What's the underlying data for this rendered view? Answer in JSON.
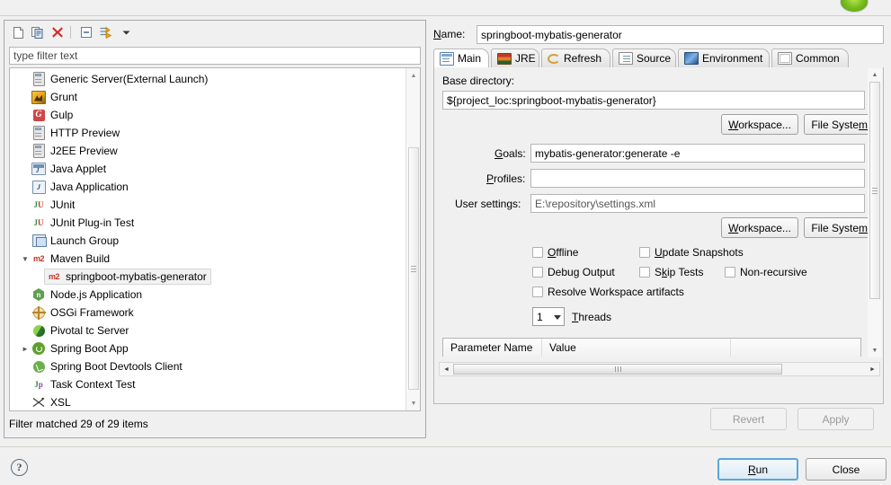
{
  "window": {
    "title_icon": "run-green-circle-icon"
  },
  "left_panel": {
    "toolbar": [
      {
        "name": "new-launch-configuration",
        "icon": "new-file-icon"
      },
      {
        "name": "duplicate-launch-configuration",
        "icon": "copy-icon"
      },
      {
        "name": "delete-launch-configuration",
        "icon": "delete-red-x-icon"
      },
      {
        "name": "collapse-all",
        "icon": "collapse-all-icon"
      },
      {
        "name": "filter-launch-configurations",
        "icon": "filter-arrow-icon"
      },
      {
        "name": "view-menu",
        "icon": "chevron-down-icon"
      }
    ],
    "filter": {
      "value": "",
      "placeholder": "type filter text"
    },
    "tree": [
      {
        "label": "Generic Server(External Launch)",
        "icon": "server-icon",
        "indent": 0,
        "twisty": "",
        "selected": false
      },
      {
        "label": "Grunt",
        "icon": "grunt-icon",
        "indent": 0,
        "twisty": "",
        "selected": false
      },
      {
        "label": "Gulp",
        "icon": "gulp-icon",
        "indent": 0,
        "twisty": "",
        "selected": false
      },
      {
        "label": "HTTP Preview",
        "icon": "server-icon",
        "indent": 0,
        "twisty": "",
        "selected": false
      },
      {
        "label": "J2EE Preview",
        "icon": "server-icon",
        "indent": 0,
        "twisty": "",
        "selected": false
      },
      {
        "label": "Java Applet",
        "icon": "java-applet-icon",
        "indent": 0,
        "twisty": "",
        "selected": false
      },
      {
        "label": "Java Application",
        "icon": "java-application-icon",
        "indent": 0,
        "twisty": "",
        "selected": false
      },
      {
        "label": "JUnit",
        "icon": "junit-icon",
        "indent": 0,
        "twisty": "",
        "selected": false
      },
      {
        "label": "JUnit Plug-in Test",
        "icon": "junit-plugin-icon",
        "indent": 0,
        "twisty": "",
        "selected": false
      },
      {
        "label": "Launch Group",
        "icon": "launch-group-icon",
        "indent": 0,
        "twisty": "",
        "selected": false
      },
      {
        "label": "Maven Build",
        "icon": "maven-m2-icon",
        "indent": 0,
        "twisty": "expanded",
        "selected": false
      },
      {
        "label": "springboot-mybatis-generator",
        "icon": "maven-m2-icon",
        "indent": 1,
        "twisty": "",
        "selected": true
      },
      {
        "label": "Node.js Application",
        "icon": "nodejs-icon",
        "indent": 0,
        "twisty": "",
        "selected": false
      },
      {
        "label": "OSGi Framework",
        "icon": "osgi-icon",
        "indent": 0,
        "twisty": "",
        "selected": false
      },
      {
        "label": "Pivotal tc Server",
        "icon": "pivotal-icon",
        "indent": 0,
        "twisty": "",
        "selected": false
      },
      {
        "label": "Spring Boot App",
        "icon": "spring-boot-icon",
        "indent": 0,
        "twisty": "collapsed",
        "selected": false
      },
      {
        "label": "Spring Boot Devtools Client",
        "icon": "spring-devtools-icon",
        "indent": 0,
        "twisty": "",
        "selected": false
      },
      {
        "label": "Task Context Test",
        "icon": "task-context-test-icon",
        "indent": 0,
        "twisty": "",
        "selected": false
      },
      {
        "label": "XSL",
        "icon": "xsl-icon",
        "indent": 0,
        "twisty": "",
        "selected": false
      }
    ],
    "status": "Filter matched 29 of 29 items"
  },
  "right_panel": {
    "name_label": "Name:",
    "name_value": "springboot-mybatis-generator",
    "tabs": [
      {
        "label": "Main",
        "icon": "main-tab-icon",
        "active": true
      },
      {
        "label": "JRE",
        "icon": "jre-icon",
        "active": false
      },
      {
        "label": "Refresh",
        "icon": "refresh-icon",
        "active": false
      },
      {
        "label": "Source",
        "icon": "source-icon",
        "active": false
      },
      {
        "label": "Environment",
        "icon": "environment-icon",
        "active": false
      },
      {
        "label": "Common",
        "icon": "common-icon",
        "active": false
      }
    ],
    "main_tab": {
      "base_directory_label": "Base directory:",
      "base_directory_value": "${project_loc:springboot-mybatis-generator}",
      "workspace_button_1": "Workspace...",
      "file_system_button_1": "File System..",
      "goals_label": "Goals:",
      "goals_value": "mybatis-generator:generate -e",
      "profiles_label": "Profiles:",
      "profiles_value": "",
      "user_settings_label": "User settings:",
      "user_settings_value": "E:\\repository\\settings.xml",
      "workspace_button_2": "Workspace...",
      "file_system_button_2": "File System..",
      "checkboxes": [
        {
          "label": "Offline",
          "checked": false
        },
        {
          "label": "Update Snapshots",
          "checked": false
        },
        {
          "label": "Debug Output",
          "checked": false
        },
        {
          "label": "Skip Tests",
          "checked": false
        },
        {
          "label": "Non-recursive",
          "checked": false
        },
        {
          "label": "Resolve Workspace artifacts",
          "checked": false
        }
      ],
      "threads_value": "1",
      "threads_label": "Threads",
      "parameter_table": {
        "columns": [
          "Parameter Name",
          "Value",
          ""
        ]
      }
    },
    "revert_button": "Revert",
    "apply_button": "Apply"
  },
  "footer": {
    "help_icon": "help-question-icon",
    "run_button": "Run",
    "close_button": "Close"
  },
  "colors": {
    "dialog_bg": "#f0f0f0",
    "field_bg": "#ffffff",
    "border": "#b5b5b5",
    "selection_bg": "#f2f2f2",
    "default_button_border": "#5aa7d8",
    "maven_red": "#c0392b",
    "spring_green": "#5fa030"
  }
}
